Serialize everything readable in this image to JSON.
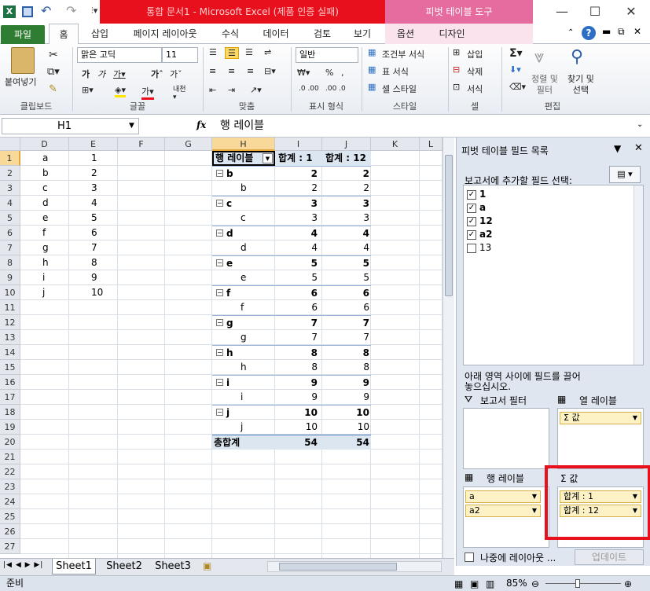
{
  "window": {
    "title": "통합 문서1 - Microsoft Excel (제품 인증 실패)",
    "context_tab": "피벗 테이블 도구"
  },
  "tabs": [
    "파일",
    "홈",
    "삽입",
    "페이지 레이아웃",
    "수식",
    "데이터",
    "검토",
    "보기",
    "옵션",
    "디자인"
  ],
  "ribbon": {
    "paste": "붙여넣기",
    "font_name": "맑은 고딕",
    "font_size": "11",
    "number_format": "일반",
    "wrap": "내림",
    "percent": "%",
    "comma": ",",
    "cond_format": "조건부 서식",
    "table_format": "표 서식",
    "cell_style": "셀 스타일",
    "insert": "삽입",
    "delete": "삭제",
    "format": "서식",
    "sort_filter": "정렬 및\n필터",
    "find_select": "찾기 및\n선택",
    "groups": [
      "클립보드",
      "글꼴",
      "맞춤",
      "표시 형식",
      "스타일",
      "셀",
      "편집"
    ]
  },
  "formula_bar": {
    "name_box": "H1",
    "fx": "fx",
    "value": "행 레이블"
  },
  "columns": [
    "D",
    "E",
    "F",
    "G",
    "H",
    "I",
    "J",
    "K",
    "L"
  ],
  "rows": [
    1,
    2,
    3,
    4,
    5,
    6,
    7,
    8,
    9,
    10,
    11,
    12,
    13,
    14,
    15,
    16,
    17,
    18,
    19,
    20,
    21,
    22,
    23,
    24,
    25,
    26,
    27
  ],
  "col_d": [
    "a",
    "b",
    "c",
    "d",
    "e",
    "f",
    "g",
    "h",
    "i",
    "j"
  ],
  "col_e": [
    "1",
    "2",
    "3",
    "4",
    "5",
    "6",
    "7",
    "8",
    "9",
    "10"
  ],
  "pivot": {
    "h_header": "행 레이블",
    "i_header": "합계 : 1",
    "j_header": "합계 : 12",
    "rows": [
      {
        "label": "b",
        "i": "2",
        "j": "2",
        "group": true
      },
      {
        "label": "b",
        "i": "2",
        "j": "2",
        "group": false
      },
      {
        "label": "c",
        "i": "3",
        "j": "3",
        "group": true
      },
      {
        "label": "c",
        "i": "3",
        "j": "3",
        "group": false
      },
      {
        "label": "d",
        "i": "4",
        "j": "4",
        "group": true
      },
      {
        "label": "d",
        "i": "4",
        "j": "4",
        "group": false
      },
      {
        "label": "e",
        "i": "5",
        "j": "5",
        "group": true
      },
      {
        "label": "e",
        "i": "5",
        "j": "5",
        "group": false
      },
      {
        "label": "f",
        "i": "6",
        "j": "6",
        "group": true
      },
      {
        "label": "f",
        "i": "6",
        "j": "6",
        "group": false
      },
      {
        "label": "g",
        "i": "7",
        "j": "7",
        "group": true
      },
      {
        "label": "g",
        "i": "7",
        "j": "7",
        "group": false
      },
      {
        "label": "h",
        "i": "8",
        "j": "8",
        "group": true
      },
      {
        "label": "h",
        "i": "8",
        "j": "8",
        "group": false
      },
      {
        "label": "i",
        "i": "9",
        "j": "9",
        "group": true
      },
      {
        "label": "i",
        "i": "9",
        "j": "9",
        "group": false
      },
      {
        "label": "j",
        "i": "10",
        "j": "10",
        "group": true
      },
      {
        "label": "j",
        "i": "10",
        "j": "10",
        "group": false
      }
    ],
    "total_label": "총합계",
    "total_i": "54",
    "total_j": "54"
  },
  "field_list": {
    "title": "피벗 테이블 필드 목록",
    "choose_label": "보고서에 추가할 필드 선택:",
    "fields": [
      {
        "name": "1",
        "checked": true
      },
      {
        "name": "a",
        "checked": true
      },
      {
        "name": "12",
        "checked": true
      },
      {
        "name": "a2",
        "checked": true
      },
      {
        "name": "13",
        "checked": false
      }
    ],
    "drag_hint": "아래 영역 사이에 필드를 끌어\n놓으십시오.",
    "report_filter": "보고서 필터",
    "column_labels": "열 레이블",
    "column_value_pill": "Σ 값",
    "row_labels": "행 레이블",
    "values": "Σ  값",
    "row_pills": [
      "a",
      "a2"
    ],
    "value_pills": [
      "합계 : 1",
      "합계 : 12"
    ],
    "defer_label": "나중에 레이아웃 ...",
    "update_button": "업데이트"
  },
  "sheets": [
    "Sheet1",
    "Sheet2",
    "Sheet3"
  ],
  "status": {
    "ready": "준비",
    "zoom": "85%"
  },
  "colors": {
    "accent_red": "#e8101c",
    "pivot_pink": "#e66b9e",
    "highlight_border": "#e8101c",
    "pill_fill": "#fdf2c6",
    "pivot_header": "#dce6f1"
  }
}
